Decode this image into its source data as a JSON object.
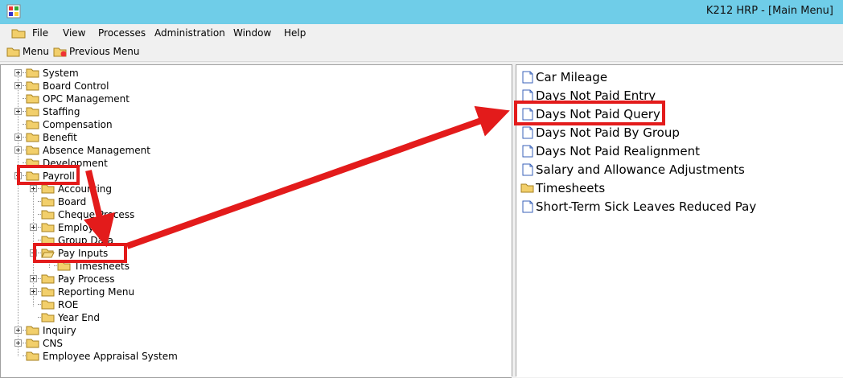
{
  "window": {
    "title": "K212 HRP - [Main Menu]"
  },
  "menubar": {
    "items": [
      "File",
      "View",
      "Processes",
      "Administration",
      "Window",
      "Help"
    ]
  },
  "toolbar": {
    "menu_label": "Menu",
    "previous_label": "Previous Menu"
  },
  "tree": {
    "nodes": [
      "System",
      "Board Control",
      "OPC Management",
      "Staffing",
      "Compensation",
      "Benefit",
      "Absence Management",
      "Development",
      "Payroll",
      "Accounting",
      "Board",
      "Cheque Process",
      "Employee",
      "Group Data",
      "Pay Inputs",
      "Timesheets",
      "Pay Process",
      "Reporting Menu",
      "ROE",
      "Year End",
      "Inquiry",
      "CNS",
      "Employee Appraisal System"
    ]
  },
  "list": {
    "items": [
      "Car Mileage",
      "Days Not Paid Entry",
      "Days Not Paid Query",
      "Days Not Paid By Group",
      "Days Not Paid Realignment",
      "Salary and Allowance Adjustments",
      "Timesheets",
      "Short-Term Sick Leaves Reduced Pay"
    ]
  },
  "colors": {
    "titlebar": "#6fcde8",
    "folder": "#f2cf6b",
    "highlight": "#e31b1b"
  }
}
